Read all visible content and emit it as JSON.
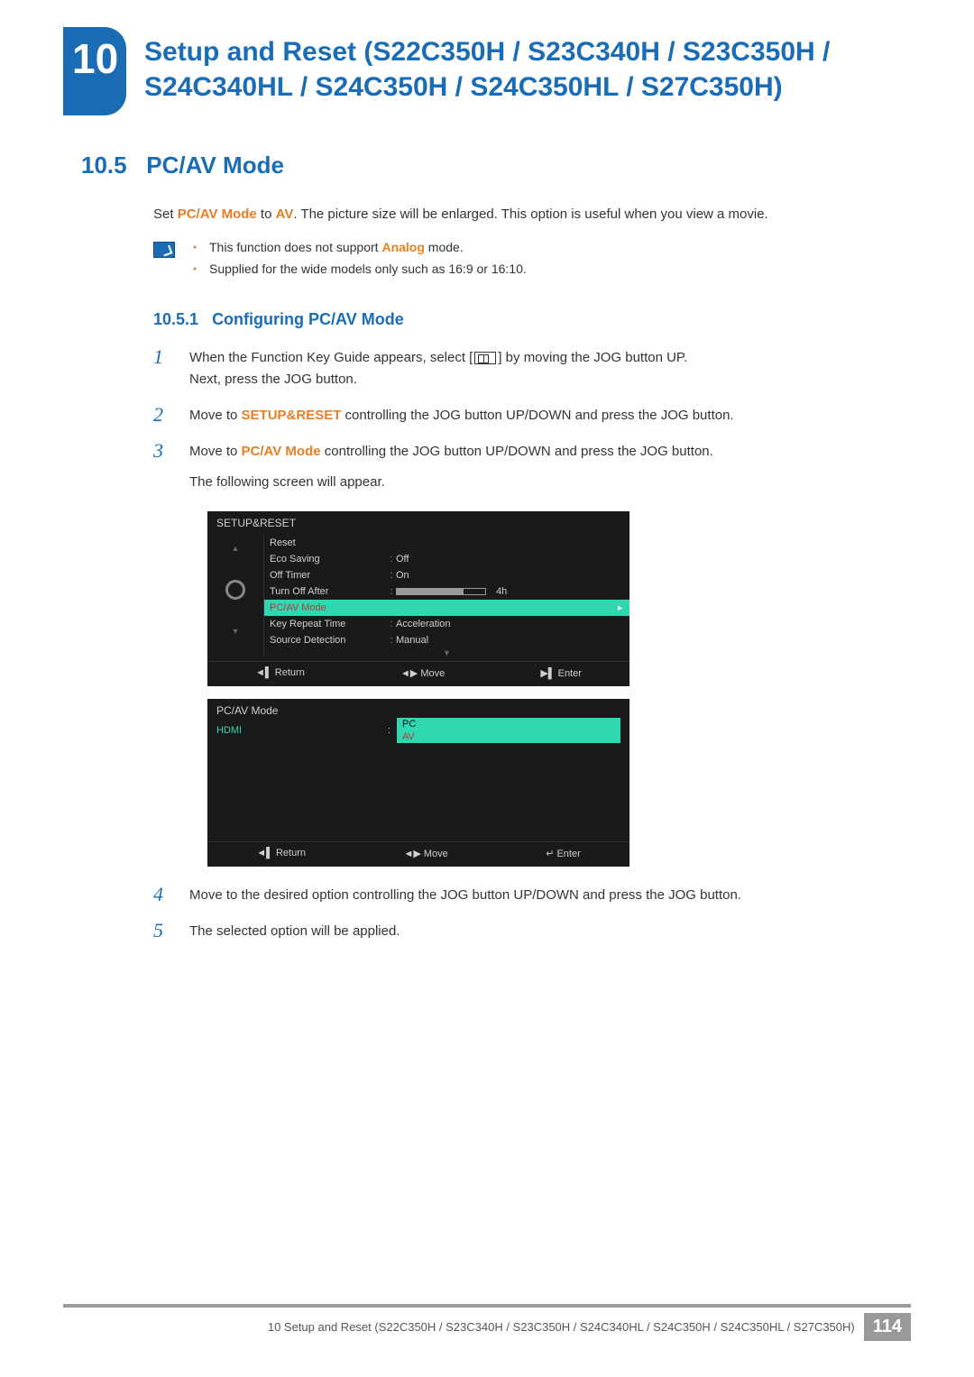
{
  "chapter": {
    "number": "10",
    "title": "Setup and Reset (S22C350H / S23C340H / S23C350H / S24C340HL / S24C350H / S24C350HL / S27C350H)"
  },
  "section": {
    "number": "10.5",
    "title": "PC/AV Mode"
  },
  "intro": {
    "prefix": "Set ",
    "bold1": "PC/AV Mode",
    "mid1": " to ",
    "bold2": "AV",
    "suffix": ". The picture size will be enlarged. This option is useful when you view a movie."
  },
  "notes": {
    "item1_pre": "This function does not support ",
    "item1_hl": "Analog",
    "item1_post": " mode.",
    "item2": "Supplied for the wide models only such as 16:9 or 16:10."
  },
  "subsection": {
    "number": "10.5.1",
    "title": "Configuring PC/AV Mode"
  },
  "steps": {
    "1": {
      "num": "1",
      "a": "When the Function Key Guide appears, select [",
      "b": "] by moving the JOG button UP.",
      "c": "Next, press the JOG button."
    },
    "2": {
      "num": "2",
      "a": "Move to ",
      "hl": "SETUP&RESET",
      "b": " controlling the JOG button UP/DOWN and press the JOG button."
    },
    "3": {
      "num": "3",
      "a": "Move to ",
      "hl": "PC/AV Mode",
      "b": " controlling the JOG button UP/DOWN and press the JOG button.",
      "c": "The following screen will appear."
    },
    "4": {
      "num": "4",
      "a": "Move to the desired option controlling the JOG button UP/DOWN and press the JOG button."
    },
    "5": {
      "num": "5",
      "a": "The selected option will be applied."
    }
  },
  "osd1": {
    "title": "SETUP&RESET",
    "rows": {
      "reset": {
        "label": "Reset",
        "val": ""
      },
      "eco": {
        "label": "Eco Saving",
        "val": "Off"
      },
      "offtimer": {
        "label": "Off Timer",
        "val": "On"
      },
      "turnoff": {
        "label": "Turn Off After",
        "val": "4h"
      },
      "pcav": {
        "label": "PC/AV Mode",
        "val": ""
      },
      "keyrepeat": {
        "label": "Key Repeat Time",
        "val": "Acceleration"
      },
      "sourcedet": {
        "label": "Source Detection",
        "val": "Manual"
      }
    },
    "footer": {
      "return": "Return",
      "move": "Move",
      "enter": "Enter"
    }
  },
  "osd2": {
    "title": "PC/AV Mode",
    "label": "HDMI",
    "opt_pc": "PC",
    "opt_av": "AV",
    "footer": {
      "return": "Return",
      "move": "Move",
      "enter": "Enter"
    }
  },
  "footer": {
    "text": "10 Setup and Reset (S22C350H / S23C340H / S23C350H / S24C340HL / S24C350H / S24C350HL / S27C350H)",
    "page": "114"
  }
}
